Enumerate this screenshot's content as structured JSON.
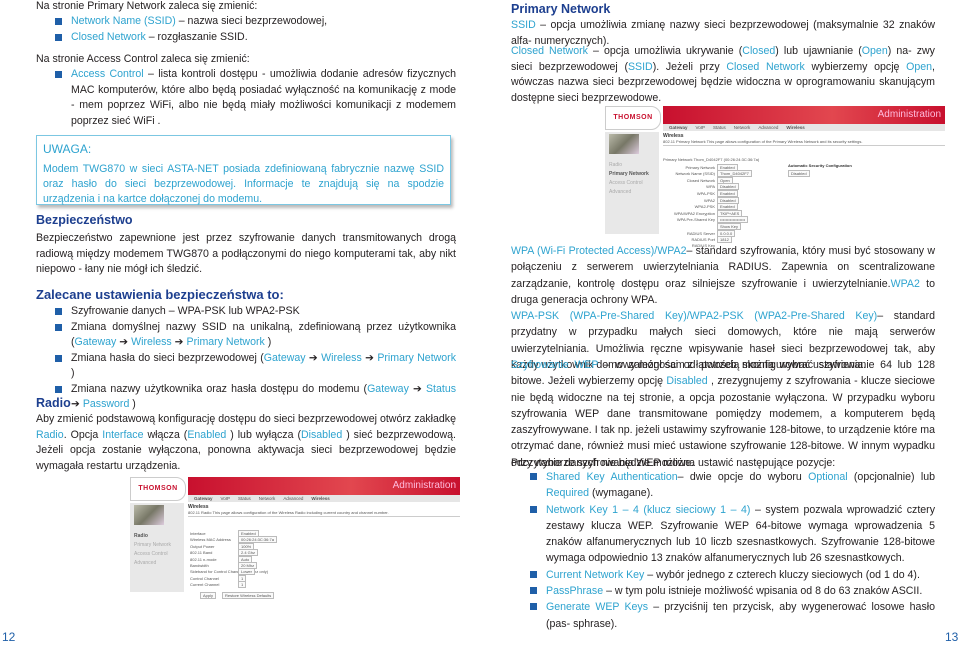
{
  "left": {
    "intro1": [
      [
        "Na stronie  ",
        ""
      ],
      [
        "Primary Network",
        ""
      ],
      [
        "    zaleca się zmienić:",
        ""
      ]
    ],
    "list1": [
      [
        [
          "Network Name (SSID)",
          "h"
        ],
        [
          " – nazwa sieci bezprzewodowej,",
          ""
        ]
      ],
      [
        [
          "Closed Network",
          "h"
        ],
        [
          " – rozgłaszanie SSID.",
          ""
        ]
      ]
    ],
    "intro2": [
      [
        "Na stronie  Access Control    zaleca się zmienić:",
        ""
      ]
    ],
    "list2": [
      [
        [
          "Access Control",
          "h"
        ],
        [
          " – lista kontroli dostępu - umożliwia dodanie adresów fizycznych MAC komputerów, które albo będą posiadać wyłączność na komunikację z mode - mem poprzez WiFi, albo nie będą miały możliwości komunikacji z modemem poprzez sieć WiFi .",
          ""
        ]
      ]
    ],
    "uwaga": {
      "title": "UWAGA:",
      "text": "Modem TWG870 w sieci ASTA-NET posiada zdefiniowaną fabrycznie nazwę SSID oraz hasło do sieci bezprzewodowej. Informacje te znajdują się na spodzie urządzenia i na kartce dołączonej do modemu."
    },
    "security_heading": "Bezpieczeństwo",
    "security_text": [
      [
        "Bezpieczeństwo zapewnione jest przez szyfrowanie danych transmitowanych drogą radiową między modemem TWG870 a podłączonymi do niego komputerami tak, aby nikt niepowo - łany nie mógł ich śledzić.",
        ""
      ]
    ],
    "recommended_heading": "Zalecane ustawienia bezpieczeństwa to:",
    "list3": [
      [
        [
          "Szyfrowanie danych – WPA-PSK lub WPA2-PSK",
          ""
        ]
      ],
      [
        [
          "Zmiana domyślnej nazwy SSID na unikalną, zdefiniowaną przez użytkownika (",
          ""
        ],
        [
          "Gateway",
          "h"
        ],
        [
          "  ➔ ",
          ""
        ],
        [
          "Wireless",
          "h"
        ],
        [
          "  ➔ ",
          ""
        ],
        [
          "Primary Network",
          "h"
        ],
        [
          "  )",
          ""
        ]
      ],
      [
        [
          "Zmiana hasła do sieci bezprzewodowej (",
          ""
        ],
        [
          "Gateway",
          "h"
        ],
        [
          "  ➔ ",
          ""
        ],
        [
          "Wireless",
          "h"
        ],
        [
          "  ➔ ",
          ""
        ],
        [
          "Primary Network",
          "h"
        ],
        [
          "  )",
          ""
        ]
      ],
      [
        [
          "Zmiana nazwy użytkownika oraz hasła dostępu do modemu (",
          ""
        ],
        [
          "Gateway",
          "h"
        ],
        [
          "  ➔ ",
          ""
        ],
        [
          "Status",
          "h"
        ],
        [
          "  ➔ ",
          ""
        ],
        [
          "Password",
          "h"
        ],
        [
          " )",
          ""
        ]
      ]
    ],
    "radio_heading": "Radio",
    "radio_text": [
      [
        "Aby zmienić podstawową konfigurację dostępu do sieci bezprzewodowej otwórz zakładkę ",
        ""
      ],
      [
        "Radio",
        "h"
      ],
      [
        ". Opcja  ",
        ""
      ],
      [
        "Interface",
        "h"
      ],
      [
        "  włącza (",
        ""
      ],
      [
        "Enabled",
        "h"
      ],
      [
        " ) lub wyłącza (",
        ""
      ],
      [
        "Disabled",
        "h"
      ],
      [
        " ) sieć bezprzewodową. Jeżeli opcja zostanie wyłączona, ponowna aktywacja sieci bezprzewodowej będzie wymagała restartu urządzenia.",
        ""
      ]
    ],
    "page_number": "12"
  },
  "screenshot_radio": {
    "logo": "THOMSON",
    "banner": "Administration",
    "tabs": [
      "Gateway",
      "VoIP",
      "Status",
      "Network",
      "Advanced",
      "Wireless"
    ],
    "title": "Wireless",
    "subtitle": "802.11 Radio   This page allows configuration of the Wireless Radio including current country and channel number.",
    "side": [
      "Radio",
      "Primary Network",
      "Access Control",
      "Advanced"
    ],
    "fields": [
      [
        "Interface",
        "Enabled"
      ],
      [
        "Wireless MAC Address",
        "00:26:24:3C:36:7a"
      ],
      [
        "Output Power",
        "100%"
      ],
      [
        "802.11 Band",
        "2.4 Ghz"
      ],
      [
        "802.11 n-mode",
        "Auto"
      ],
      [
        "Bandwidth",
        "20 Mhz"
      ],
      [
        "Sideband for Control Channel (40 Mhz only)",
        "Lower"
      ],
      [
        "Control Channel",
        "1"
      ],
      [
        "Current Channel",
        "1"
      ]
    ],
    "buttons": [
      "Apply",
      "Restore Wireless Defaults"
    ]
  },
  "right": {
    "heading": "Primary Network",
    "p1": [
      [
        "SSID",
        "h"
      ],
      [
        " – opcja umożliwia zmianę nazwy sieci bezprzewodowej (maksymalnie 32 znaków alfa- numerycznych).",
        ""
      ]
    ],
    "p2": [
      [
        "Closed Network",
        "h"
      ],
      [
        " – opcja umożliwia ukrywanie (",
        ""
      ],
      [
        "Closed",
        "h"
      ],
      [
        ") lub ujawnianie (",
        ""
      ],
      [
        "Open",
        "h"
      ],
      [
        ") na- zwy sieci bezprzewodowej (",
        ""
      ],
      [
        "SSID",
        "h"
      ],
      [
        "). Jeżeli przy ",
        ""
      ],
      [
        "Closed Network",
        "h"
      ],
      [
        " wybierzemy opcję ",
        ""
      ],
      [
        "Open",
        "h"
      ],
      [
        ", wówczas nazwa sieci bezprzewodowej będzie widoczna w oprogramowaniu skanującym dostępne sieci bezprzewodowe.",
        ""
      ]
    ],
    "p3": [
      [
        "WPA (Wi-Fi Protected Access)/WPA2",
        "h"
      ],
      [
        "– standard szyfrowania, który musi być stosowany w połączeniu z serwerem uwierzytelniania RADIUS. Zapewnia on scentralizowane zarządzanie, kontrolę dostępu oraz silniejsze szyfrowanie i uwierzytelnianie.",
        ""
      ],
      [
        "WPA2",
        "h"
      ],
      [
        "  to druga generacja ochrony WPA.",
        ""
      ]
    ],
    "p4": [
      [
        "WPA-PSK (WPA-Pre-Shared Key)/WPA2-PSK (WPA2-Pre-Shared Key)",
        "h"
      ],
      [
        "– standard przydatny w przypadku małych sieci domowych, które nie mają serwerów uwierzytelniania. Umożliwia ręczne wpisywanie haseł sieci bezprzewodowej tak, aby każdy użytkownik domowy mógł sam z łatwością skonfigurować ustawienia.",
        ""
      ]
    ],
    "p5": [
      [
        "Szyfrowanie WEP",
        "h"
      ],
      [
        " – w zależności od potrzeb można wybrać szyfrowanie 64 lub 128 bitowe. Jeżeli wybierzemy opcję ",
        ""
      ],
      [
        "Disabled",
        "h"
      ],
      [
        " , zrezygnujemy z szyfrowania - klucze sieciowe nie będą widoczne na tej stronie, a opcja pozostanie wyłączona. W przypadku wyboru szyfrowania WEP dane transmitowane pomiędzy modemem, a komputerem będą zaszyfrowywane. I tak np. jeżeli ustawimy szyfrowanie 128-bitowe, to urządzenie które ma otrzymać dane, również musi mieć ustawione szyfrowanie 128-bitowe. W innym wypadku odczytanie danych nie będzie możliwe.",
        ""
      ]
    ],
    "p6": [
      [
        "Przy wyborze szyfrowania WEP można ustawić następujące pozycje:",
        ""
      ]
    ],
    "list": [
      [
        [
          "Shared Key Authentication",
          "h"
        ],
        [
          "– dwie opcje do wyboru ",
          ""
        ],
        [
          "Optional",
          "h"
        ],
        [
          " (opcjonalnie) lub ",
          ""
        ],
        [
          "Required",
          "h"
        ],
        [
          "  (wymagane).",
          ""
        ]
      ],
      [
        [
          "Network Key 1 – 4 (klucz sieciowy 1 – 4)",
          "h"
        ],
        [
          " – system pozwala wprowadzić cztery zestawy klucza WEP. Szyfrowanie WEP 64-bitowe wymaga wprowadzenia 5 znaków alfanumerycznych lub 10 liczb szesnastkowych. Szyfrowanie 128-bitowe wymaga odpowiednio 13 znaków alfanumerycznych lub 26 szesnastkowych.",
          ""
        ]
      ],
      [
        [
          "Current Network Key",
          "h"
        ],
        [
          " – wybór jednego z czterech kluczy sieciowych (od 1 do 4).",
          ""
        ]
      ],
      [
        [
          "PassPhrase",
          "h"
        ],
        [
          " – w tym polu istnieje możliwość wpisania od 8 do 63 znaków ASCII.",
          ""
        ]
      ],
      [
        [
          "Generate WEP Keys",
          "h"
        ],
        [
          " – przyciśnij ten przycisk, aby wygenerować losowe hasło (pas- sphrase).",
          ""
        ]
      ]
    ],
    "page_number": "13"
  },
  "screenshot_primary": {
    "logo": "THOMSON",
    "banner": "Administration",
    "tabs": [
      "Gateway",
      "VoIP",
      "Status",
      "Network",
      "Advanced",
      "Wireless"
    ],
    "title": "Wireless",
    "subtitle": "802.11 Primary Network   This page allows configuration of the Primary Wireless Network and its security settings.",
    "side": [
      "Radio",
      "Primary Network",
      "Access Control",
      "Advanced"
    ],
    "fields": [
      [
        "Primary Network Thom_D4042F7 (00:26:24:3C:36:7a)",
        ""
      ],
      [
        "Primary Network",
        "Enabled"
      ],
      [
        "Network Name (SSID)",
        "Thom_D4042F7"
      ],
      [
        "Closed Network",
        "Open"
      ],
      [
        "WPA",
        "Disabled"
      ],
      [
        "WPA-PSK",
        "Enabled"
      ],
      [
        "WPA2",
        "Disabled"
      ],
      [
        "WPA2-PSK",
        "Enabled"
      ],
      [
        "WPA/WPA2 Encryption",
        "TKIP+AES"
      ],
      [
        "WPA Pre-Shared Key",
        "••••••••••••••••••"
      ],
      [
        "",
        "Show Key"
      ],
      [
        "RADIUS Server",
        "0.0.0.0"
      ],
      [
        "RADIUS Port",
        "1812"
      ],
      [
        "RADIUS Key",
        ""
      ]
    ],
    "auto_security_title": "Automatic Security Configuration",
    "auto_security_value": "Disabled"
  },
  "colors": {
    "highlight": "#2ea3cf",
    "heading": "#1d3f8f",
    "bullet": "#1f5fa8",
    "banner": "#c8102e"
  }
}
